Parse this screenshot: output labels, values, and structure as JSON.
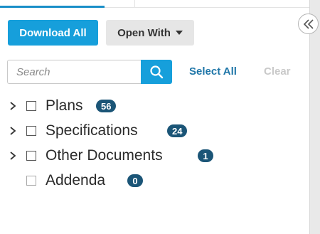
{
  "toolbar": {
    "download_all_label": "Download All",
    "open_with_label": "Open With"
  },
  "search": {
    "placeholder": "Search",
    "value": ""
  },
  "actions": {
    "select_all_label": "Select All",
    "clear_label": "Clear"
  },
  "tree": {
    "items": [
      {
        "label": "Plans",
        "count": "56",
        "expandable": true
      },
      {
        "label": "Specifications",
        "count": "24",
        "expandable": true
      },
      {
        "label": "Other Documents",
        "count": "1",
        "expandable": true
      },
      {
        "label": "Addenda",
        "count": "0",
        "expandable": false
      }
    ]
  },
  "colors": {
    "primary": "#169fdb",
    "link": "#1f76a8",
    "badge": "#1b5577",
    "disabled_link": "#c9c9c9"
  },
  "icons": {
    "collapse": "double-chevron-left-icon",
    "search": "search-icon",
    "expand": "chevron-right-icon",
    "dropdown": "caret-down-icon"
  }
}
